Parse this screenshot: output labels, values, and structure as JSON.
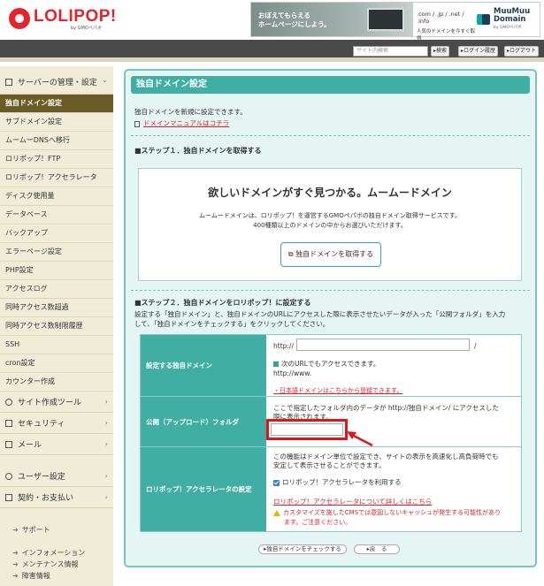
{
  "header": {
    "logo_name": "LOLIPOP!",
    "logo_sub": "by GMOペパボ",
    "banner_line1": "おぼえてもらえる",
    "banner_line2": "ホームページにしよう。",
    "banner_domains": ".com / .jp / .net / .info",
    "banner_tagline": "人気のドメインを今すぐ取得",
    "muumuu_line1": "MuuMuu",
    "muumuu_line2": "Domain",
    "muumuu_sub": "by GMOペパボ"
  },
  "utilbar": {
    "search_placeholder": "サイト内検索",
    "search_btn": "検索",
    "login_history_btn": "ログイン履歴",
    "logout_btn": "ログアウト"
  },
  "sidebar": {
    "server_cat": "サーバーの管理・設定",
    "items": [
      "独自ドメイン設定",
      "サブドメイン設定",
      "ムームーDNSへ移行",
      "ロリポップ！FTP",
      "ロリポップ！アクセラレータ",
      "ディスク使用量",
      "データベース",
      "バックアップ",
      "エラーページ設定",
      "PHP設定",
      "アクセスログ",
      "同時アクセス数超過",
      "同時アクセス数制限履歴",
      "SSH",
      "cron設定",
      "カウンター作成"
    ],
    "cat_site": "サイト作成ツール",
    "cat_security": "セキュリティ",
    "cat_mail": "メール",
    "cat_user": "ユーザー設定",
    "cat_contract": "契約・お支払い",
    "support": "サポート",
    "info": "インフォメーション",
    "maintenance": "メンテナンス情報",
    "trouble": "障害情報"
  },
  "main": {
    "title": "独自ドメイン設定",
    "intro": "独自ドメインを新規に設定できます。",
    "manual_link": "ドメインマニュアルはコチラ",
    "step1_heading": "■ステップ１．独自ドメインを取得する",
    "muumuu_box_heading": "欲しいドメインがすぐ見つかる。ムームードメイン",
    "muumuu_box_desc1": "ムームードメインは、ロリポップ！を運営するGMOペパボの独自ドメイン取得サービスです。",
    "muumuu_box_desc2": "400種類以上のドメインの中からお選びいただけます。",
    "get_domain_btn": "独自ドメインを取得する",
    "step2_heading": "■ステップ２．独自ドメインをロリポップ！に設定する",
    "step2_desc1": "設定する「独自ドメイン」と、独自ドメインのURLにアクセスした際に表示させたいデータが入った「公開フォルダ」を入力",
    "step2_desc2": "して、「独自ドメインをチェックする」をクリックしてください。",
    "row1_label": "設定する独自ドメイン",
    "http_prefix": "http://",
    "slash": "/",
    "also_access": "次のURLでもアクセスできます。",
    "www_prefix": "http://www.",
    "jp_domain_link": "・日本語ドメインはこちらから登録できます。",
    "row2_label": "公開（アップロード）フォルダ",
    "row2_desc1": "ここで指定したフォルダ内のデータが http://独自ドメイン/ にアクセスした",
    "row2_desc2": "際に表示されます。",
    "row3_label": "ロリポップ！アクセラレータの設定",
    "row3_desc1": "この機能はドメイン単位で設定でき、サイトの表示を高速化し高負荷時でも",
    "row3_desc2": "安定して表示させることができます。",
    "accelerator_check": "ロリポップ！アクセラレータを利用する",
    "accelerator_link": "ロリポップ！アクセラレータについて詳しくはこちら",
    "warn1": "カスタマイズを施したCMSでは意図しないキャッシュが発生する可能性があり",
    "warn2": "ます。ご注意ください。",
    "check_btn": "独自ドメインをチェックする",
    "back_btn": "戻　る"
  },
  "colors": {
    "accent": "#41aea4",
    "sidebar_bg": "#f1ecd8",
    "sidebar_active": "#6b5b26",
    "link_red": "#d8232a",
    "highlight_red": "#e0151b"
  }
}
